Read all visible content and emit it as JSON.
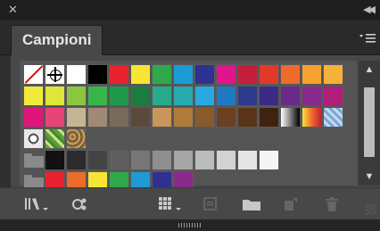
{
  "titlebar": {
    "close_glyph": "✕",
    "collapse_glyph": "◀◀"
  },
  "panel": {
    "tab_label": "Campioni",
    "menu_icon": "panel-menu-icon"
  },
  "swatches": {
    "row1": [
      "none",
      "registration",
      "#ffffff",
      "#000000",
      "#e8222e",
      "#f7e633",
      "#2faa4a",
      "#1c9bd7",
      "#2e3192",
      "#e0148c",
      "#c41f3a",
      "#e23a2a",
      "#ef6b2b",
      "#f7a22f",
      "#f6b23a"
    ],
    "row2": [
      "#f2ea3a",
      "#dfe63a",
      "#8cc63f",
      "#39b54a",
      "#1f9a4c",
      "#1a7c3f",
      "#27ab8a",
      "#27aab0",
      "#29a9e0",
      "#2078c2",
      "#2e3a8c",
      "#3a2a86",
      "#6a2a8a",
      "#8a2a8c",
      "#b01e79"
    ],
    "row3": [
      "#e0147a",
      "#e8447a",
      "#c5b594",
      "#a08a76",
      "#7a6a5a",
      "#5a4a3c",
      "#c8955a",
      "#b07a3a",
      "#8a5a2a",
      "#6a4020",
      "#5a3418",
      "#3e2410",
      "gradient-bw",
      "gradient-orange",
      "gradient-blue"
    ],
    "row4": [
      "pattern-dots",
      "pattern-foliage",
      "pattern-pebbles"
    ],
    "row5_group": "gray-group",
    "row5": [
      "#111111",
      "#2b2b2b",
      "#444444",
      "#5e5e5e",
      "#777777",
      "#8f8f8f",
      "#a6a6a6",
      "#bcbcbc",
      "#d2d2d2",
      "#e6e6e6",
      "#f5f5f5"
    ],
    "row6_group": "color-group",
    "row6": [
      "#e8222e",
      "#ef6b2b",
      "#f7e633",
      "#2faa4a",
      "#1c9bd7",
      "#2e3192",
      "#8a2a8c"
    ]
  },
  "toolbar": {
    "library_icon": "swatch-libraries-menu-icon",
    "kind_icon": "show-swatch-kinds-icon",
    "options_icon": "swatch-options-icon",
    "new_group_icon": "new-color-group-icon",
    "new_swatch_icon": "new-swatch-icon",
    "delete_icon": "delete-swatch-icon"
  }
}
